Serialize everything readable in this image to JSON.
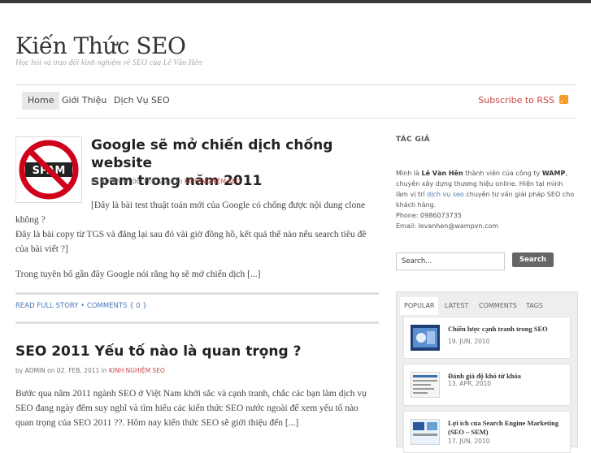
{
  "site": {
    "title": "Kiến Thức SEO",
    "description": "Học hỏi và trao đổi kinh nghiệm về SEO của Lê Văn Hên"
  },
  "nav": {
    "items": [
      "Home",
      "Giới Thiệu",
      "Dịch Vụ SEO"
    ],
    "rss": "Subscribe to RSS"
  },
  "posts": [
    {
      "title_line1": "Google sẽ mở chiến dịch chống website",
      "title_line2": "spam trong năm 2011",
      "meta_prefix": "by ADMIN on 06. FEB, 2011 in ",
      "category": "KINH NGHIỆM SEO",
      "thumb_text": "SPAM",
      "excerpt1": "[Đây là bài test thuật toán mới của Google có chống được nội dung clone không ?",
      "excerpt2": "Đây là bài copy từ TGS và đăng lại sau đó vài giờ đồng hồ, kết quả thế nào nếu search tiêu đề của bài viết ?]",
      "excerpt3": "Trong tuyên bố gần đây Google nói rằng họ sẽ mở chiến dịch [...]",
      "read_more": "READ FULL STORY",
      "comments": "COMMENTS { 0 }"
    },
    {
      "title": "SEO 2011 Yếu tố nào là quan trọng ?",
      "meta_prefix": "by ADMIN on 02. FEB, 2011 in ",
      "category": "KINH NGHIỆM SEO",
      "excerpt": "Bước qua năm 2011 ngành SEO ở Việt Nam khởi sắc và cạnh tranh, chắc các bạn làm dịch vụ SEO đang ngày đêm suy nghĩ và tìm hiểu các kiến thức SEO nước ngoài để xem yếu tố nào quan trọng của SEO 2011 ??. Hôm nay kiến thức SEO sẽ giới thiệu đến [...]"
    }
  ],
  "sidebar": {
    "author_heading": "TÁC GIẢ",
    "about_1": "Mình là ",
    "about_name": "Lê Văn Hên",
    "about_2": " thành viên của công ty ",
    "about_company": "WAMP",
    "about_3": ", chuyên xây dựng thương hiệu online. Hiện tại mình làm vị trí ",
    "about_link": "dịch vụ seo",
    "about_4": " chuyên tư vấn giải pháp SEO cho khách hàng.",
    "phone": "Phone: 0986073735",
    "email": "Email: levanhen@wampvn.com",
    "search_value": "Search...",
    "search_button": "Search",
    "tabs": [
      "POPULAR",
      "LATEST",
      "COMMENTS",
      "TAGS"
    ],
    "popular": [
      {
        "title": "Chiến lược cạnh tranh trong SEO",
        "date": "19. JUN, 2010"
      },
      {
        "title": "Đánh giá độ khó từ khóa",
        "date": "13. APR, 2010"
      },
      {
        "title": "Lợi ích của Search Engine Marketing (SEO – SEM)",
        "date": "17. JUN, 2010"
      }
    ]
  },
  "colors": {
    "accent": "#c44444",
    "link": "#4a7ab8",
    "topbar": "#3a3a3a"
  }
}
